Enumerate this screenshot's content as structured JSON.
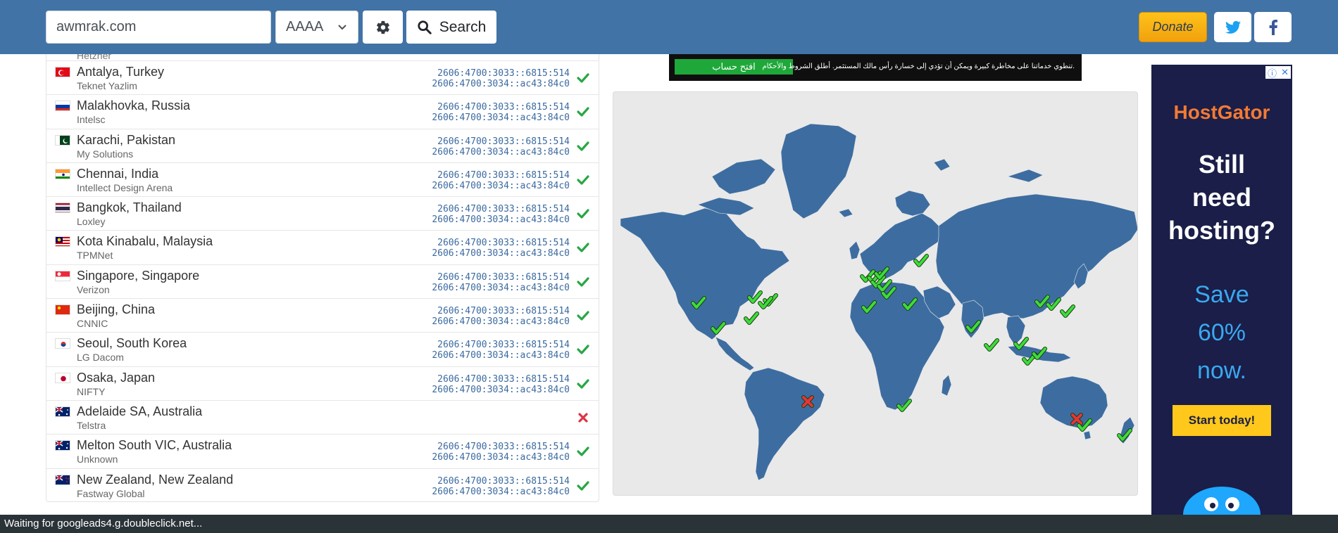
{
  "header": {
    "domain_value": "awmrak.com",
    "record_type": "AAAA",
    "search_label": "Search",
    "donate_label": "Donate"
  },
  "results": {
    "partial_isp": "Hetzner",
    "rows": [
      {
        "location": "Antalya, Turkey",
        "isp": "Teknet Yazlim",
        "ip1": "2606:4700:3033::6815:514",
        "ip2": "2606:4700:3034::ac43:84c0",
        "status": "ok"
      },
      {
        "location": "Malakhovka, Russia",
        "isp": "Intelsc",
        "ip1": "2606:4700:3033::6815:514",
        "ip2": "2606:4700:3034::ac43:84c0",
        "status": "ok"
      },
      {
        "location": "Karachi, Pakistan",
        "isp": "My Solutions",
        "ip1": "2606:4700:3033::6815:514",
        "ip2": "2606:4700:3034::ac43:84c0",
        "status": "ok"
      },
      {
        "location": "Chennai, India",
        "isp": "Intellect Design Arena",
        "ip1": "2606:4700:3033::6815:514",
        "ip2": "2606:4700:3034::ac43:84c0",
        "status": "ok"
      },
      {
        "location": "Bangkok, Thailand",
        "isp": "Loxley",
        "ip1": "2606:4700:3033::6815:514",
        "ip2": "2606:4700:3034::ac43:84c0",
        "status": "ok"
      },
      {
        "location": "Kota Kinabalu, Malaysia",
        "isp": "TPMNet",
        "ip1": "2606:4700:3033::6815:514",
        "ip2": "2606:4700:3034::ac43:84c0",
        "status": "ok"
      },
      {
        "location": "Singapore, Singapore",
        "isp": "Verizon",
        "ip1": "2606:4700:3033::6815:514",
        "ip2": "2606:4700:3034::ac43:84c0",
        "status": "ok"
      },
      {
        "location": "Beijing, China",
        "isp": "CNNIC",
        "ip1": "2606:4700:3033::6815:514",
        "ip2": "2606:4700:3034::ac43:84c0",
        "status": "ok"
      },
      {
        "location": "Seoul, South Korea",
        "isp": "LG Dacom",
        "ip1": "2606:4700:3033::6815:514",
        "ip2": "2606:4700:3034::ac43:84c0",
        "status": "ok"
      },
      {
        "location": "Osaka, Japan",
        "isp": "NIFTY",
        "ip1": "2606:4700:3033::6815:514",
        "ip2": "2606:4700:3034::ac43:84c0",
        "status": "ok"
      },
      {
        "location": "Adelaide SA, Australia",
        "isp": "Telstra",
        "ip1": "",
        "ip2": "",
        "status": "fail"
      },
      {
        "location": "Melton South VIC, Australia",
        "isp": "Unknown",
        "ip1": "2606:4700:3033::6815:514",
        "ip2": "2606:4700:3034::ac43:84c0",
        "status": "ok"
      },
      {
        "location": "New Zealand, New Zealand",
        "isp": "Fastway Global",
        "ip1": "2606:4700:3033::6815:514",
        "ip2": "2606:4700:3034::ac43:84c0",
        "status": "ok"
      }
    ]
  },
  "ad_top": {
    "button_text": "افتح حساب",
    "body_text": "تنطوي خدماتنا على مخاطرة كبيرة ويمكن أن تؤدي إلى خسارة رأس مالك المستثمر. أطلق الشروط والأحكام."
  },
  "ad_right": {
    "brand": "HostGator",
    "headline_1": "Still",
    "headline_2": "need",
    "headline_3": "hosting?",
    "offer_1": "Save",
    "offer_2": "60%",
    "offer_3": "now.",
    "cta": "Start today!"
  },
  "statusbar": {
    "text": "Waiting for googleads4.g.doubleclick.net..."
  },
  "colors": {
    "navbar": "#4173a6",
    "ok": "#28a745",
    "fail": "#dc3545",
    "map_land": "#3d6da0"
  }
}
